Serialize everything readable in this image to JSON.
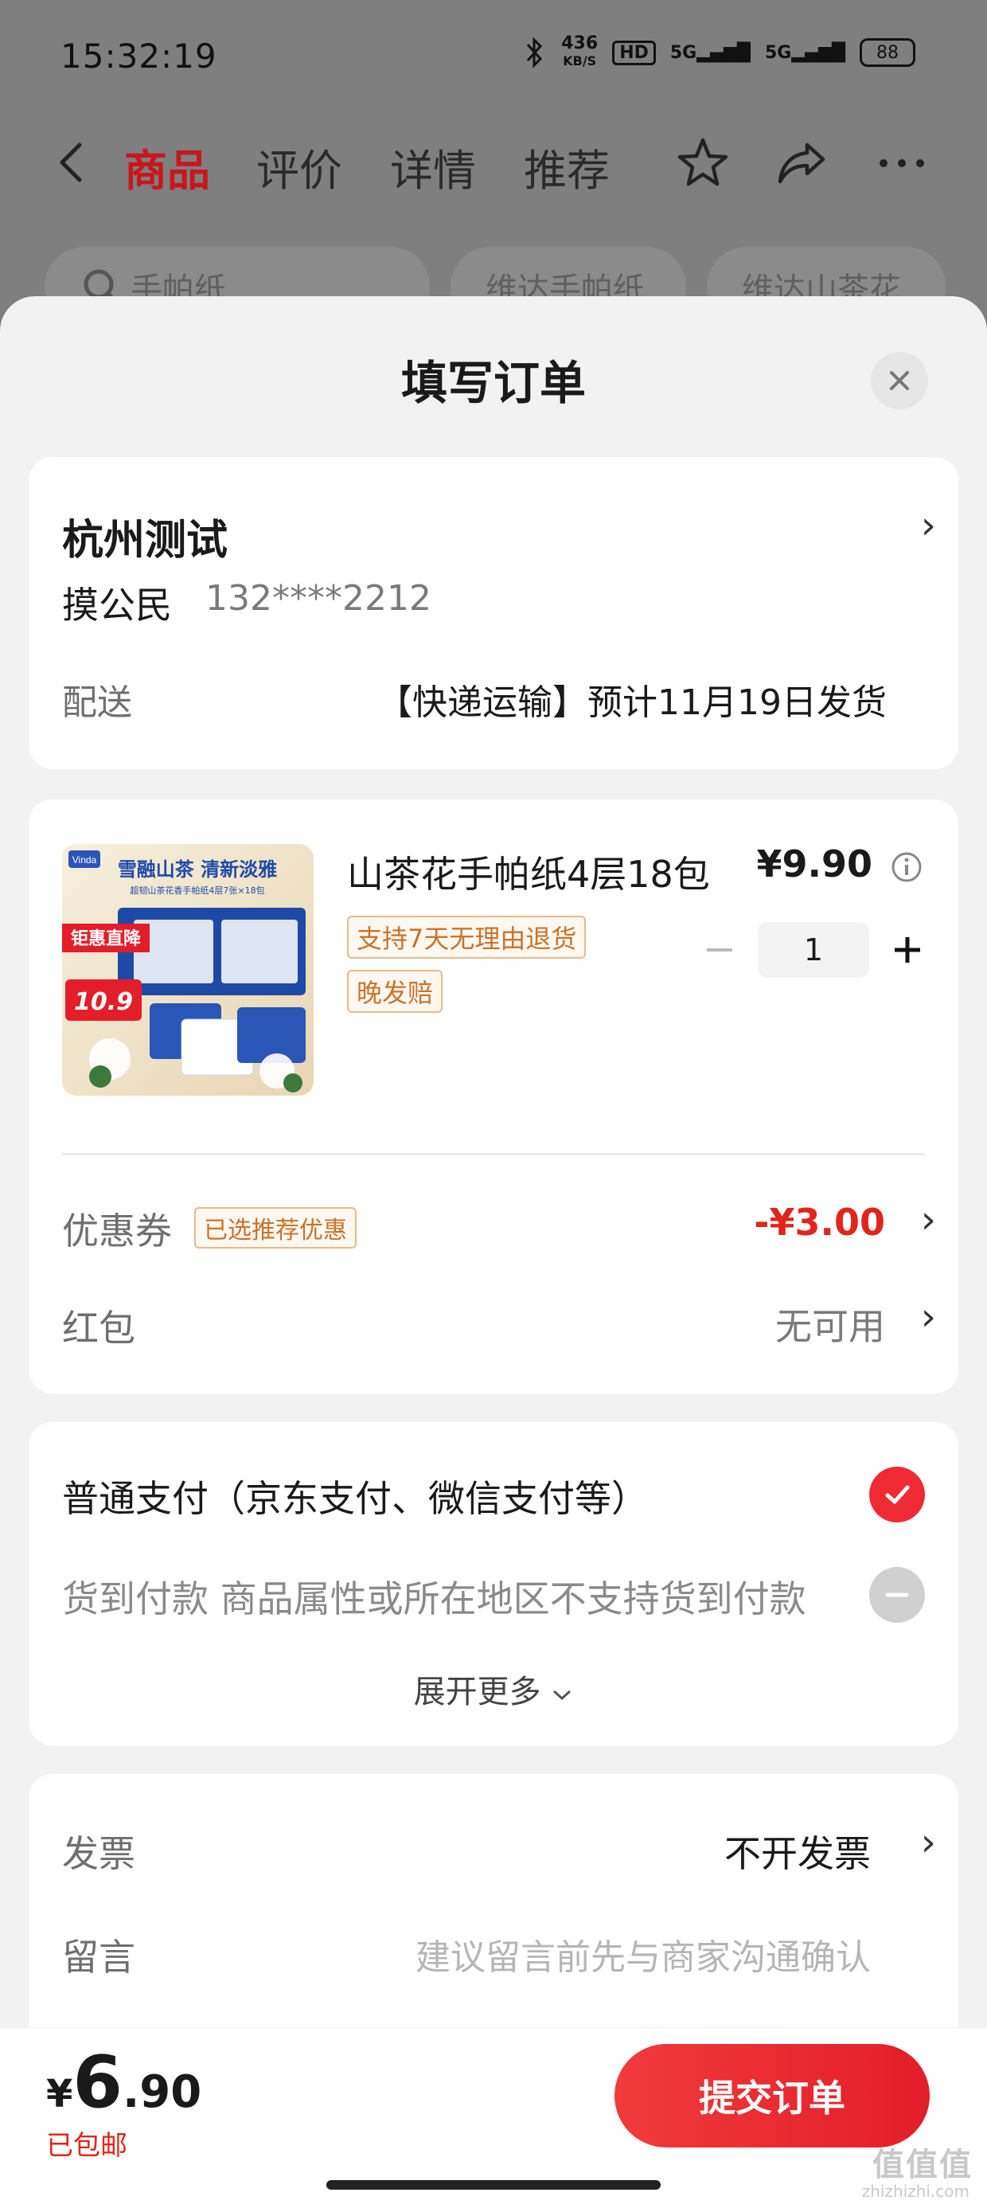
{
  "status_bar": {
    "time": "15:32:19",
    "speed_value": "436",
    "speed_unit": "KB/S",
    "hd_label": "HD",
    "signal1": "5G",
    "signal2": "5G",
    "battery": "88"
  },
  "nav": {
    "tabs": [
      "商品",
      "评价",
      "详情",
      "推荐"
    ],
    "active_tab": "商品"
  },
  "search": {
    "query": "手帕纸",
    "chips": [
      "维达手帕纸",
      "维达山茶花"
    ]
  },
  "sheet": {
    "title": "填写订单"
  },
  "address": {
    "name": "杭州测试",
    "person": "摸公民",
    "phone": "132****2212",
    "shipping_label": "配送",
    "shipping_value": "【快递运输】预计11月19日发货"
  },
  "product": {
    "name": "山茶花手帕纸4层18包",
    "price": "¥9.90",
    "tags": [
      "支持7天无理由退货",
      "晚发赔"
    ],
    "quantity": "1",
    "image": {
      "headline": "雪融山茶 清新淡雅",
      "subline": "超韧山茶花香手帕纸4层7张×18包",
      "badge": "钜惠直降",
      "badge_price": "10.9",
      "brand": "Vinda"
    }
  },
  "coupon": {
    "label": "优惠券",
    "tag": "已选推荐优惠",
    "value": "-¥3.00"
  },
  "redpacket": {
    "label": "红包",
    "value": "无可用"
  },
  "payment": {
    "option1": "普通支付（京东支付、微信支付等）",
    "option2": "货到付款 商品属性或所在地区不支持货到付款",
    "more": "展开更多"
  },
  "invoice": {
    "label": "发票",
    "value": "不开发票"
  },
  "message": {
    "label": "留言",
    "placeholder": "建议留言前先与商家沟通确认"
  },
  "footer": {
    "currency": "¥",
    "total_int": "6",
    "total_dec": ".90",
    "shipping_note": "已包邮",
    "submit_label": "提交订单"
  },
  "watermark": {
    "main": "值值值",
    "sub": "zhizhizhi.com"
  },
  "colors": {
    "accent": "#e1251b",
    "nav_active": "#c8161d",
    "tag_border": "#e9b98a",
    "tag_text": "#c8732c"
  }
}
